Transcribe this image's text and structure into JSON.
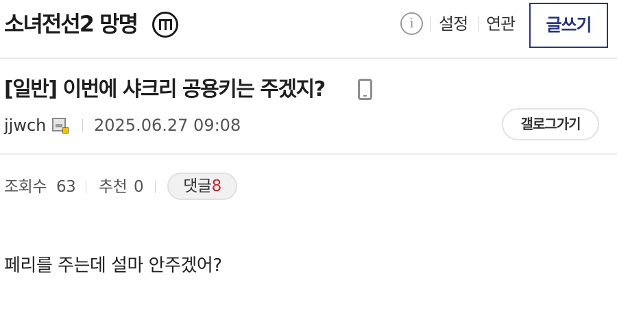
{
  "header": {
    "gallery_title": "소녀전선2 망명",
    "minor_gallery_badge": "m-circle-icon",
    "info_icon": "info-circle-icon",
    "settings_label": "설정",
    "related_label": "연관",
    "write_label": "글쓰기",
    "accent_color": "#29367c"
  },
  "post": {
    "title": "[일반] 이번에 샤크리 공용키는 주겠지?",
    "device_icon": "mobile-phone-icon",
    "author": "jjwch",
    "author_level_icon": "member-level-icon",
    "date": "2025.06.27 09:08",
    "go_gallery_label": "갤로그가기",
    "stats": {
      "views_label": "조회수",
      "views": "63",
      "recommend_label": "추천",
      "recommend": "0",
      "comments_label": "댓글",
      "comments": "8",
      "comment_color": "#c0262d"
    },
    "body": "페리를 주는데 설마 안주겠어?"
  }
}
